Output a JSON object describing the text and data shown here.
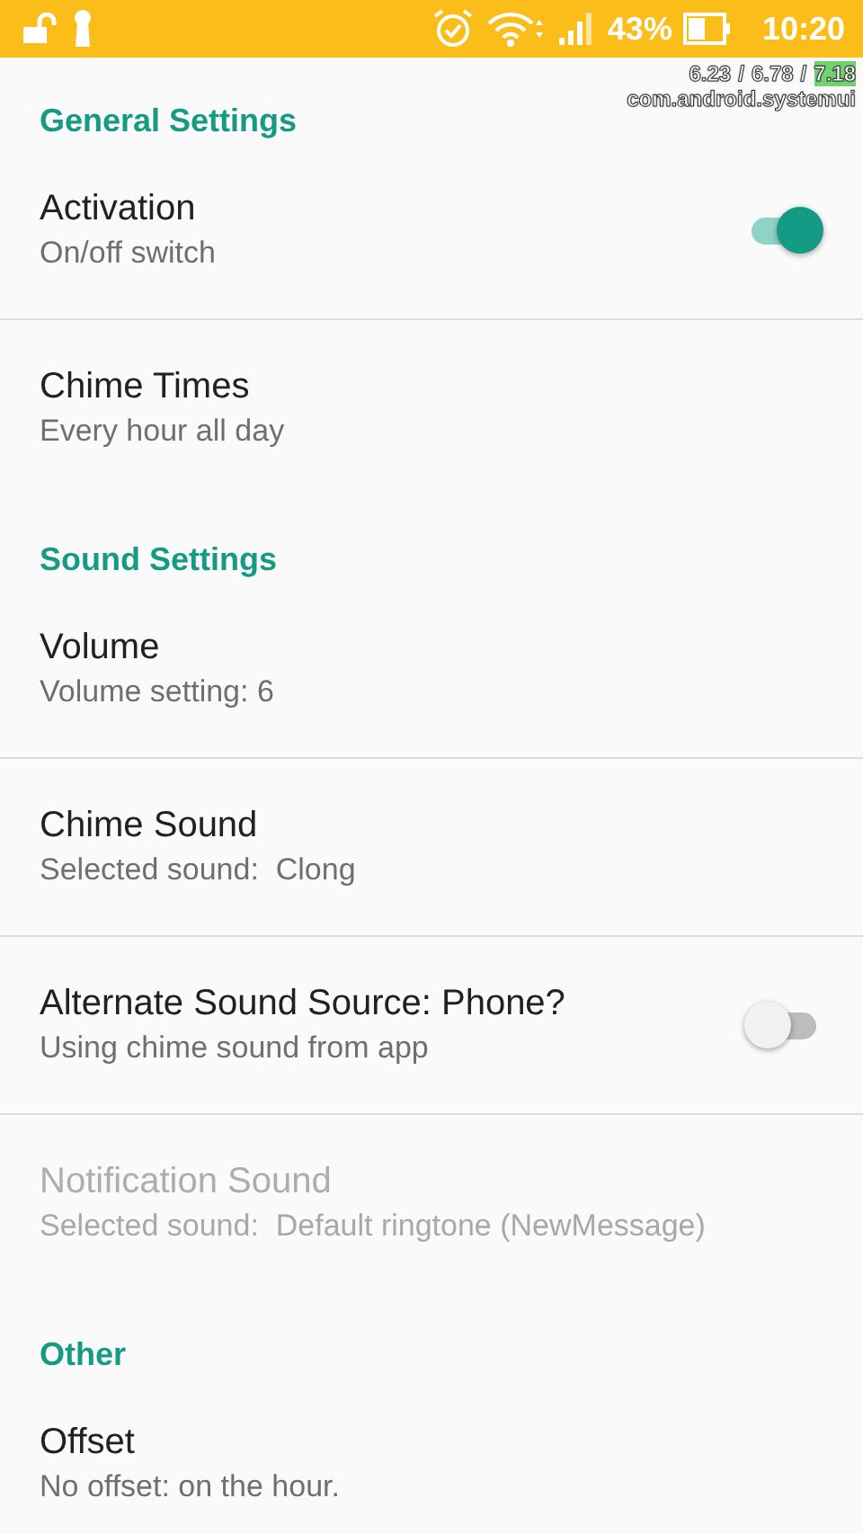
{
  "status_bar": {
    "battery": "43%",
    "time": "10:20"
  },
  "overlay": {
    "loads": [
      "6.23",
      "6.78",
      "7.18"
    ],
    "separator": "/",
    "process": "com.android.systemui"
  },
  "sections": [
    {
      "title": "General Settings",
      "items": [
        {
          "kind": "switch",
          "title": "Activation",
          "subtitle": "On/off switch",
          "on": true,
          "disabled": false
        },
        {
          "kind": "plain",
          "title": "Chime Times",
          "subtitle": "Every hour all day",
          "disabled": false
        }
      ]
    },
    {
      "title": "Sound Settings",
      "items": [
        {
          "kind": "plain",
          "title": "Volume",
          "subtitle": "Volume setting: 6",
          "disabled": false
        },
        {
          "kind": "plain",
          "title": "Chime Sound",
          "subtitle": "Selected sound:  Clong",
          "disabled": false
        },
        {
          "kind": "switch",
          "title": "Alternate Sound Source: Phone?",
          "subtitle": "Using chime sound from app",
          "on": false,
          "disabled": false
        },
        {
          "kind": "plain",
          "title": "Notification Sound",
          "subtitle": "Selected sound:  Default ringtone (NewMessage)",
          "disabled": true
        }
      ]
    },
    {
      "title": "Other",
      "items": [
        {
          "kind": "plain",
          "title": "Offset",
          "subtitle": "No offset: on the hour.",
          "disabled": false
        }
      ]
    }
  ]
}
